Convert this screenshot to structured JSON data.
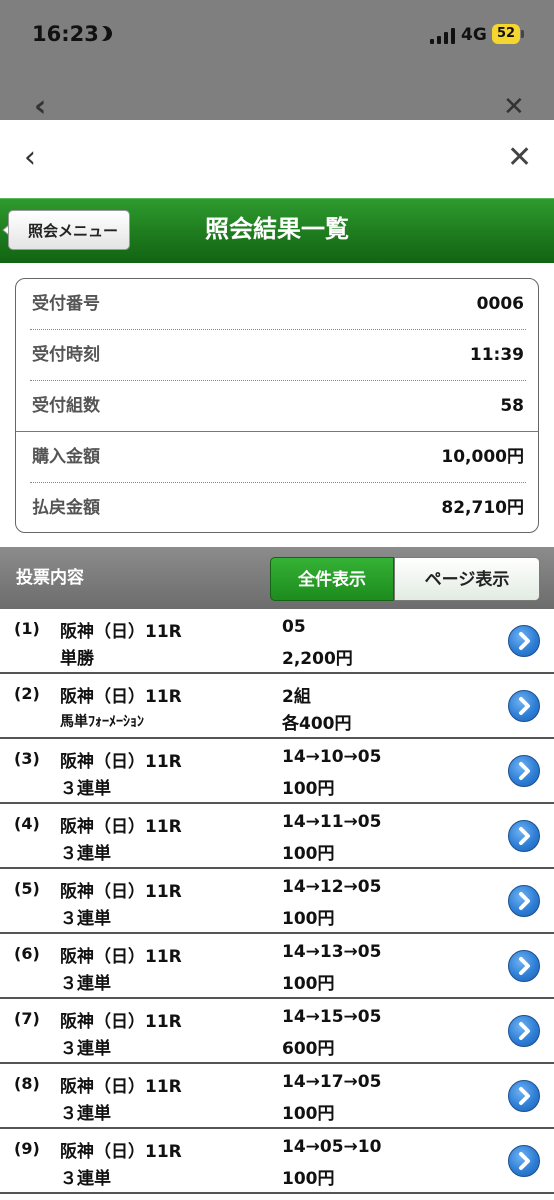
{
  "status_bar": {
    "time": "16:23",
    "network": "4G",
    "battery": "52"
  },
  "nav": {
    "back_glyph": "‹",
    "close_glyph": "✕"
  },
  "header": {
    "menu_button": "照会メニュー",
    "title": "照会結果一覧"
  },
  "summary": [
    {
      "label": "受付番号",
      "value": "0006"
    },
    {
      "label": "受付時刻",
      "value": "11:39"
    },
    {
      "label": "受付組数",
      "value": "58"
    },
    {
      "label": "購入金額",
      "value": "10,000円"
    },
    {
      "label": "払戻金額",
      "value": "82,710円"
    }
  ],
  "vote_section": {
    "label": "投票内容",
    "all_button": "全件表示",
    "page_button": "ページ表示"
  },
  "bets": [
    {
      "num": "(1)",
      "race": "阪神（日）11R",
      "type": "単勝",
      "combo": "05",
      "amount": "2,200円"
    },
    {
      "num": "(2)",
      "race": "阪神（日）11R",
      "type": "馬単ﾌｫｰﾒｰｼｮﾝ",
      "combo": "2組",
      "amount": "各400円"
    },
    {
      "num": "(3)",
      "race": "阪神（日）11R",
      "type": "３連単",
      "combo": "14→10→05",
      "amount": "100円"
    },
    {
      "num": "(4)",
      "race": "阪神（日）11R",
      "type": "３連単",
      "combo": "14→11→05",
      "amount": "100円"
    },
    {
      "num": "(5)",
      "race": "阪神（日）11R",
      "type": "３連単",
      "combo": "14→12→05",
      "amount": "100円"
    },
    {
      "num": "(6)",
      "race": "阪神（日）11R",
      "type": "３連単",
      "combo": "14→13→05",
      "amount": "100円"
    },
    {
      "num": "(7)",
      "race": "阪神（日）11R",
      "type": "３連単",
      "combo": "14→15→05",
      "amount": "600円"
    },
    {
      "num": "(8)",
      "race": "阪神（日）11R",
      "type": "３連単",
      "combo": "14→17→05",
      "amount": "100円"
    },
    {
      "num": "(9)",
      "race": "阪神（日）11R",
      "type": "３連単",
      "combo": "14→05→10",
      "amount": "100円"
    }
  ],
  "icons": {
    "detail": "chevron-right-circle-icon",
    "back": "chevron-left-icon",
    "close": "close-icon"
  },
  "colors": {
    "header_green": "#1e7b1e",
    "active_button_green": "#2ca12c",
    "detail_blue": "#2f7fd6"
  }
}
